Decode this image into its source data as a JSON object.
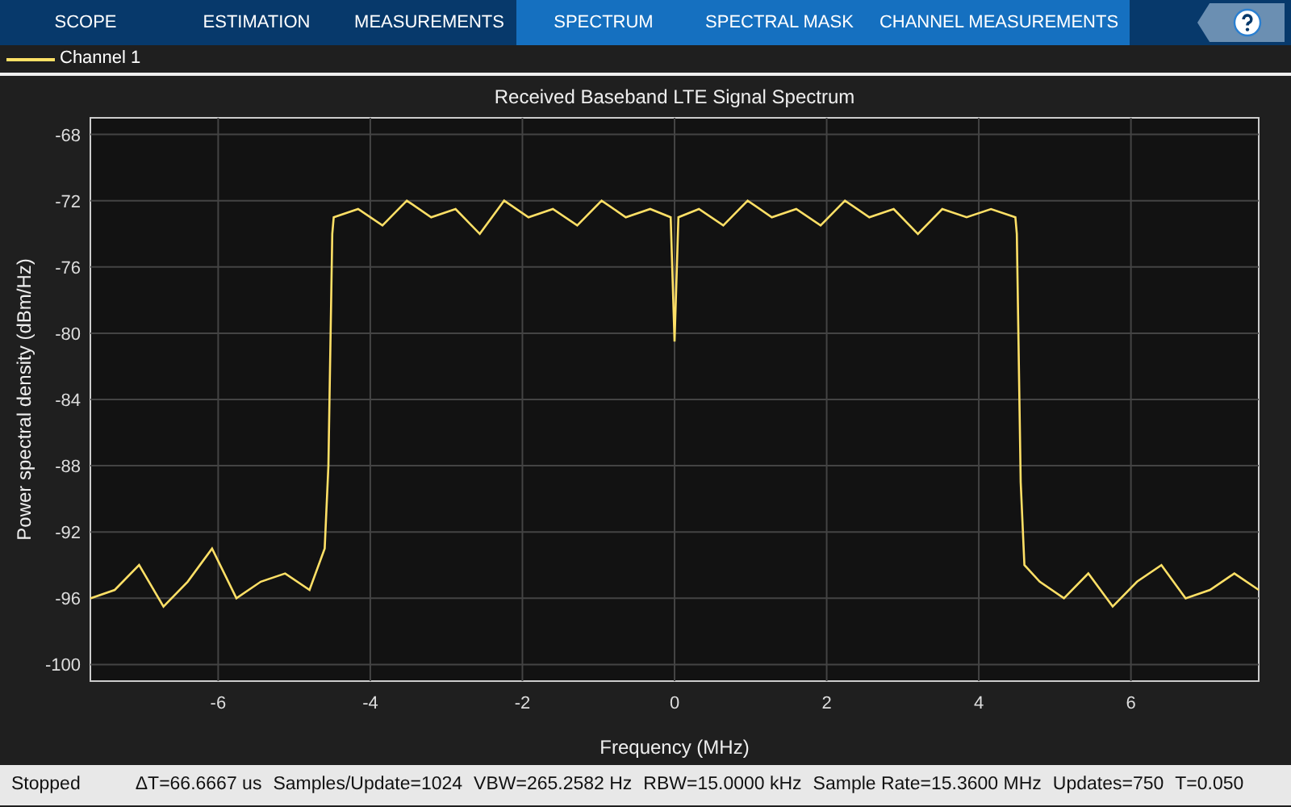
{
  "tabs": [
    {
      "label": "SCOPE",
      "highlighted": false
    },
    {
      "label": "ESTIMATION",
      "highlighted": false
    },
    {
      "label": "MEASUREMENTS",
      "highlighted": false
    },
    {
      "label": "SPECTRUM",
      "highlighted": true
    },
    {
      "label": "SPECTRAL MASK",
      "highlighted": true
    },
    {
      "label": "CHANNEL MEASUREMENTS",
      "highlighted": true
    }
  ],
  "plot": {
    "chart_data": {
      "type": "line",
      "grid": true,
      "title": "Received Baseband LTE Signal Spectrum",
      "xlabel": "Frequency (MHz)",
      "ylabel": "Power spectral density (dBm/Hz)",
      "xlim": [
        -7.68,
        7.68
      ],
      "ylim": [
        -101,
        -67
      ],
      "xticks": [
        -6,
        -4,
        -2,
        0,
        2,
        4,
        6
      ],
      "yticks": [
        -100,
        -96,
        -92,
        -88,
        -84,
        -80,
        -76,
        -72,
        -68
      ],
      "x": [
        -7.68,
        -7.36,
        -7.04,
        -6.72,
        -6.4,
        -6.08,
        -5.76,
        -5.44,
        -5.12,
        -4.8,
        -4.6,
        -4.55,
        -4.5,
        -4.48,
        -4.16,
        -3.84,
        -3.52,
        -3.2,
        -2.88,
        -2.56,
        -2.24,
        -1.92,
        -1.6,
        -1.28,
        -0.96,
        -0.64,
        -0.32,
        -0.05,
        0,
        0.05,
        0.32,
        0.64,
        0.96,
        1.28,
        1.6,
        1.92,
        2.24,
        2.56,
        2.88,
        3.2,
        3.52,
        3.84,
        4.16,
        4.48,
        4.5,
        4.55,
        4.6,
        4.8,
        5.12,
        5.44,
        5.76,
        6.08,
        6.4,
        6.72,
        7.04,
        7.36,
        7.68
      ],
      "series": [
        {
          "name": "Channel 1",
          "color": "#ffe066",
          "values": [
            -96,
            -95.5,
            -94,
            -96.5,
            -95,
            -93,
            -96,
            -95,
            -94.5,
            -95.5,
            -93,
            -88,
            -74,
            -73,
            -72.5,
            -73.5,
            -72,
            -73,
            -72.5,
            -74,
            -72,
            -73,
            -72.5,
            -73.5,
            -72,
            -73,
            -72.5,
            -73,
            -80.5,
            -73,
            -72.5,
            -73.5,
            -72,
            -73,
            -72.5,
            -73.5,
            -72,
            -73,
            -72.5,
            -74,
            -72.5,
            -73,
            -72.5,
            -73,
            -74,
            -89,
            -94,
            -95,
            -96,
            -94.5,
            -96.5,
            -95,
            -94,
            -96,
            -95.5,
            -94.5,
            -95.5
          ]
        }
      ]
    }
  },
  "status_bar": {
    "state": "Stopped",
    "readouts": [
      "ΔT=66.6667 us",
      "Samples/Update=1024",
      "VBW=265.2582 Hz",
      "RBW=15.0000 kHz",
      "Sample Rate=15.3600 MHz",
      "Updates=750",
      "T=0.050"
    ]
  }
}
